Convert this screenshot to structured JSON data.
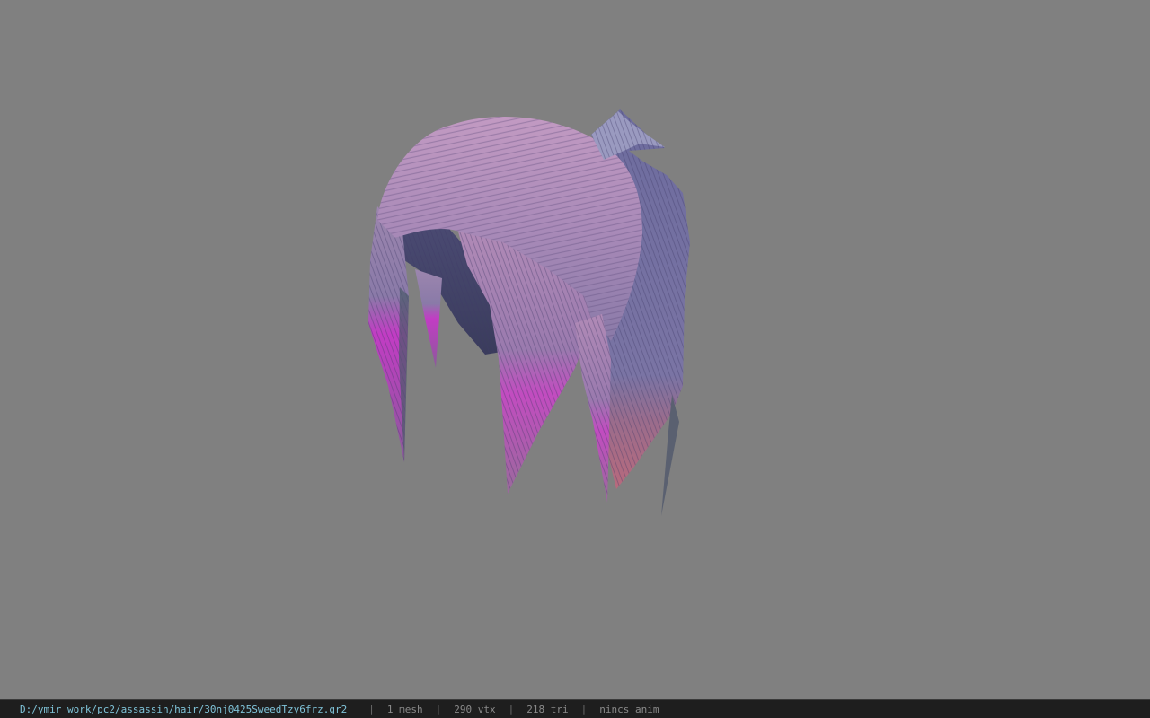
{
  "viewer": {
    "background_color": "#808080",
    "model": {
      "subject": "hair mesh",
      "colors": {
        "lilac": "#b48ab8",
        "pink_highlight": "#d19bc8",
        "blue_purple": "#6e6a9a",
        "dark_blue": "#3e4062",
        "magenta_tip": "#c23cc4",
        "rose_tip": "#b86a7c",
        "teal_edge": "#4a5a6a"
      }
    }
  },
  "status_bar": {
    "path": "D:/ymir work/pc2/assassin/hair/30nj0425SweedTzy6frz.gr2",
    "separator": "|",
    "mesh": "1 mesh",
    "vertices": "290 vtx",
    "triangles": "218 tri",
    "animation": "nincs anim"
  }
}
